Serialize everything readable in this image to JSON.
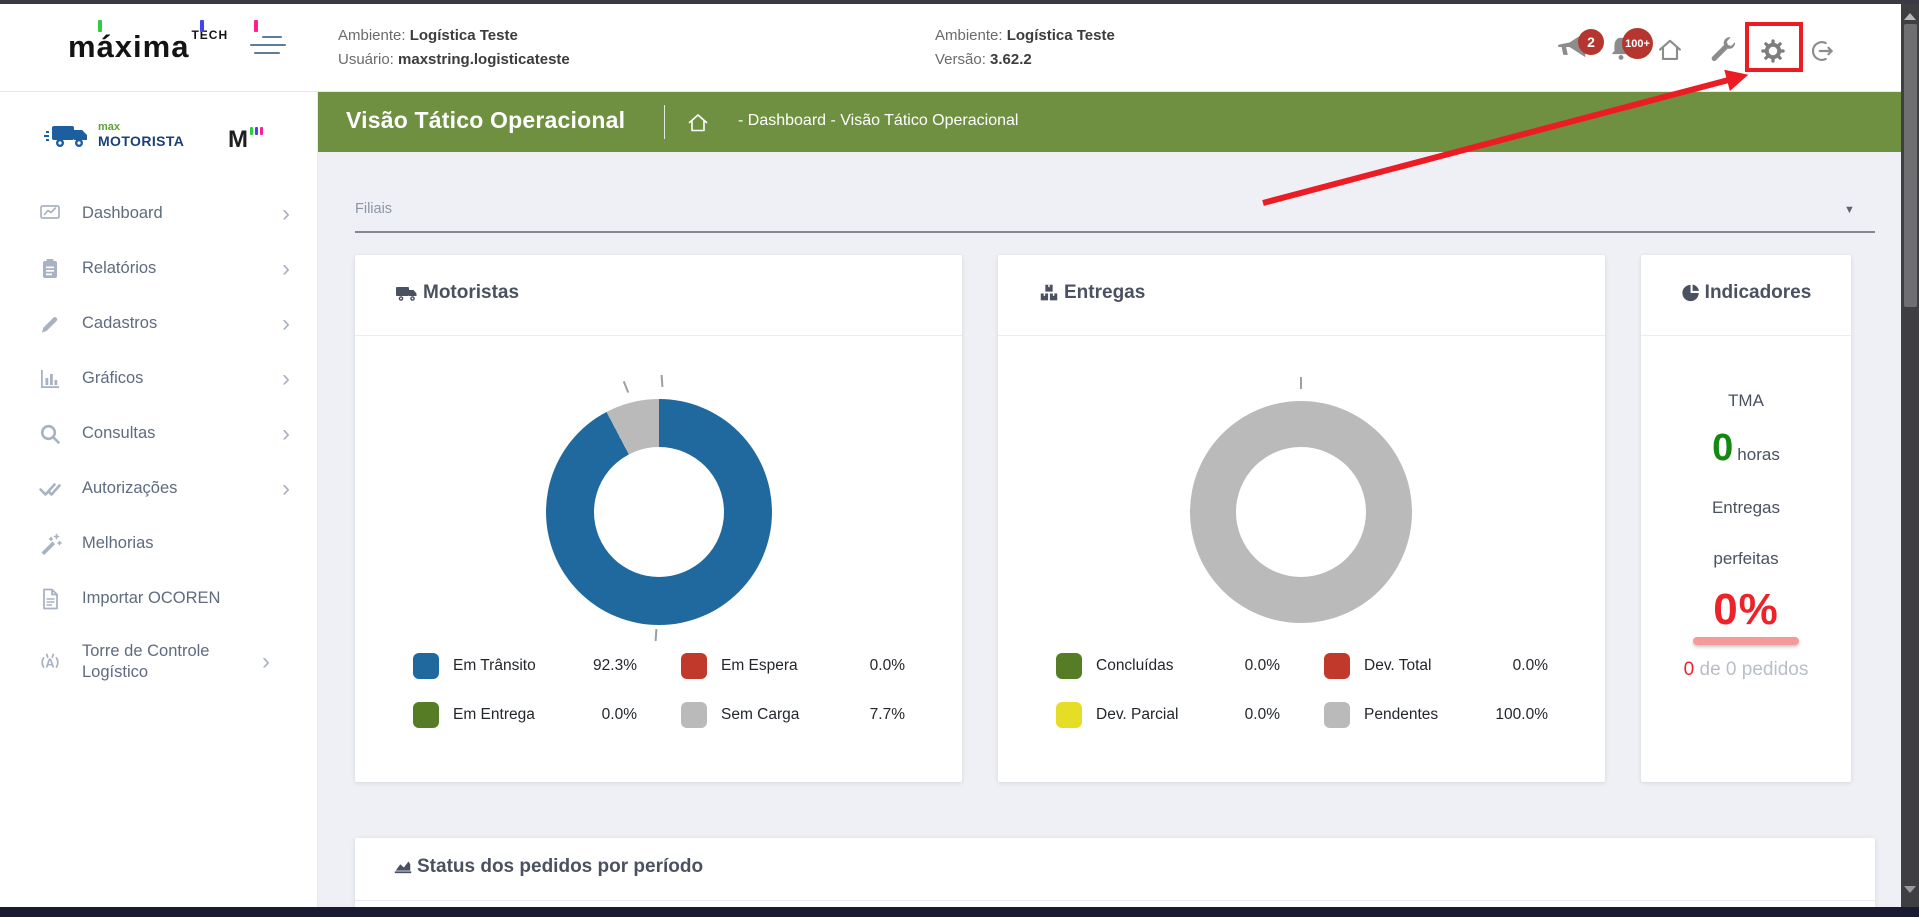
{
  "header": {
    "brand": {
      "name": "máxima",
      "suffix": "TECH"
    },
    "env_blocks": [
      {
        "line1_label": "Ambiente:",
        "line1_value": "Logística Teste",
        "line2_label": "Usuário:",
        "line2_value": "maxstring.logisticateste"
      },
      {
        "line1_label": "Ambiente:",
        "line1_value": "Logística Teste",
        "line2_label": "Versão:",
        "line2_value": "3.62.2"
      }
    ],
    "notifications": {
      "announcements_badge": "2",
      "alerts_badge": "100+"
    }
  },
  "titlebar": {
    "title": "Visão Tático Operacional",
    "breadcrumb": "- Dashboard - Visão Tático Operacional"
  },
  "sidebar": {
    "product_logo": {
      "prefix": "max",
      "name": "MOTORISTA",
      "mini": "M"
    },
    "items": [
      {
        "label": "Dashboard",
        "has_submenu": true
      },
      {
        "label": "Relatórios",
        "has_submenu": true
      },
      {
        "label": "Cadastros",
        "has_submenu": true
      },
      {
        "label": "Gráficos",
        "has_submenu": true
      },
      {
        "label": "Consultas",
        "has_submenu": true
      },
      {
        "label": "Autorizações",
        "has_submenu": true
      },
      {
        "label": "Melhorias",
        "has_submenu": false
      },
      {
        "label": "Importar OCOREN",
        "has_submenu": false
      },
      {
        "label": "Torre de Controle Logístico",
        "has_submenu": true
      }
    ]
  },
  "filters": {
    "filiais": {
      "label": "Filiais"
    }
  },
  "chart_data": [
    {
      "type": "pie",
      "title": "Motoristas",
      "legend_position": "bottom",
      "segments": [
        {
          "label": "Em Trânsito",
          "value": 92.3,
          "pct": "92.3%",
          "color": "#20699F"
        },
        {
          "label": "Em Espera",
          "value": 0.0,
          "pct": "0.0%",
          "color": "#C0392B"
        },
        {
          "label": "Em Entrega",
          "value": 0.0,
          "pct": "0.0%",
          "color": "#567D25"
        },
        {
          "label": "Sem Carga",
          "value": 7.7,
          "pct": "7.7%",
          "color": "#BABABA"
        }
      ]
    },
    {
      "type": "pie",
      "title": "Entregas",
      "legend_position": "bottom",
      "segments": [
        {
          "label": "Concluídas",
          "value": 0.0,
          "pct": "0.0%",
          "color": "#567D25"
        },
        {
          "label": "Dev. Total",
          "value": 0.0,
          "pct": "0.0%",
          "color": "#C0392B"
        },
        {
          "label": "Dev. Parcial",
          "value": 0.0,
          "pct": "0.0%",
          "color": "#E6DE26"
        },
        {
          "label": "Pendentes",
          "value": 100.0,
          "pct": "100.0%",
          "color": "#BABABA"
        }
      ]
    }
  ],
  "indicators": {
    "title": "Indicadores",
    "tma_label": "TMA",
    "tma_value": "0",
    "tma_unit": "horas",
    "perfect_label_1": "Entregas",
    "perfect_label_2": "perfeitas",
    "perfect_value": "0%",
    "orders_value": "0",
    "orders_rest": " de 0 pedidos"
  },
  "status_card": {
    "title": "Status dos pedidos por período"
  },
  "colors": {
    "accent_green": "#6E9040",
    "annotation_red": "#EB1C24",
    "badge_red": "#B5362E",
    "logo_ticks": [
      "#2ecc40",
      "#4444ee",
      "#ff1f8f"
    ]
  }
}
